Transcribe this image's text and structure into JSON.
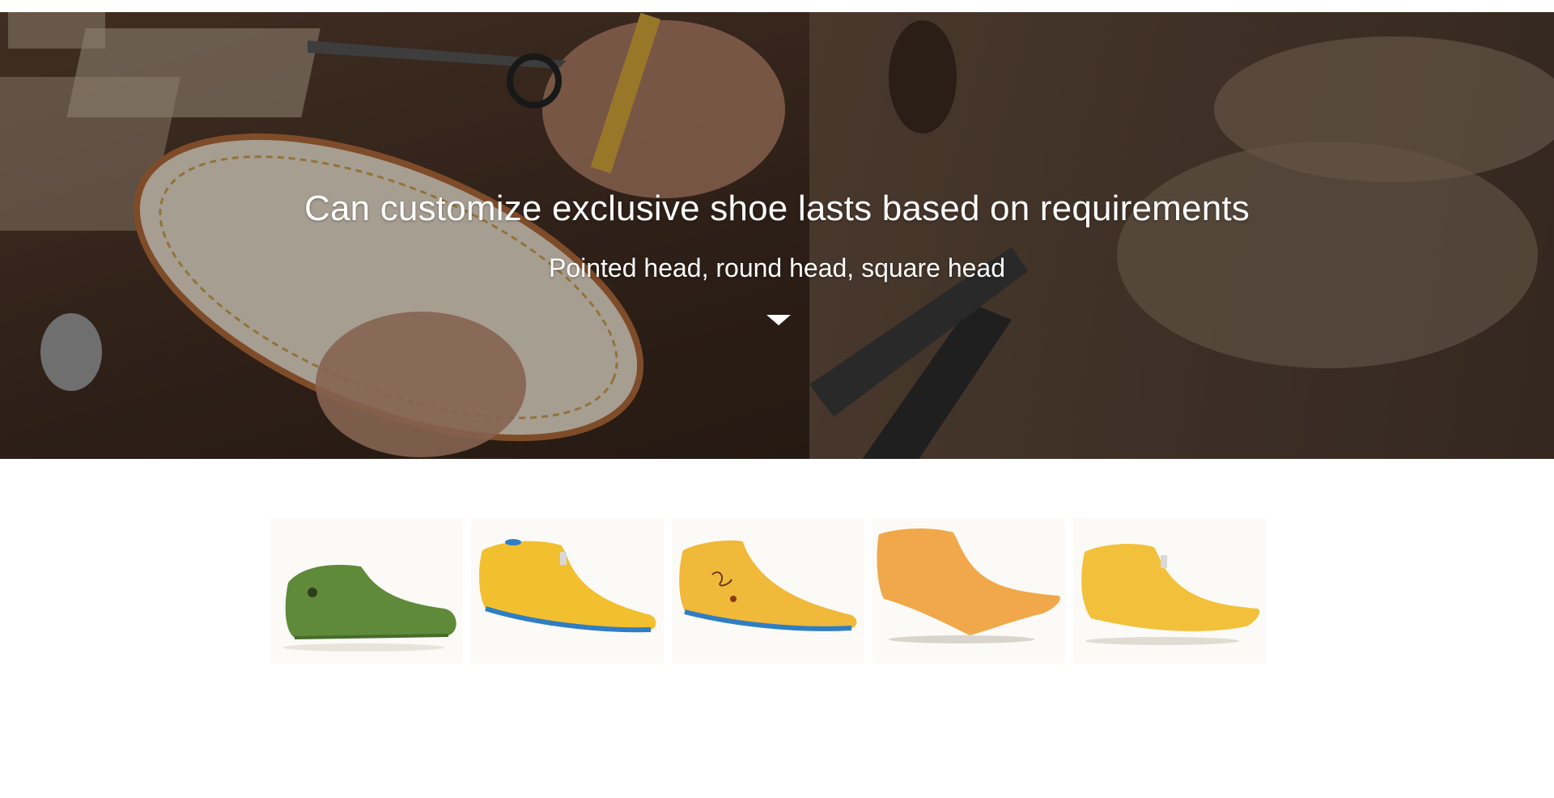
{
  "hero": {
    "title": "Can customize exclusive shoe lasts based on requirements",
    "subtitle": "Pointed head, round head, square head",
    "scroll_icon": "caret-down-icon",
    "background_image": "craftsman-stitching-insole-photo"
  },
  "products": [
    {
      "name": "green-shoe-last",
      "color": "#5e8a3a"
    },
    {
      "name": "yellow-shoe-last-blue-sole",
      "color": "#f2bf2f"
    },
    {
      "name": "yellow-shoe-last-blue-sole-marked",
      "color": "#f0b93a"
    },
    {
      "name": "orange-pointed-shoe-last",
      "color": "#f0a84a"
    },
    {
      "name": "yellow-pointed-shoe-last",
      "color": "#f2c03a"
    }
  ],
  "colors": {
    "hero_text": "#ffffff",
    "page_background": "#ffffff"
  }
}
